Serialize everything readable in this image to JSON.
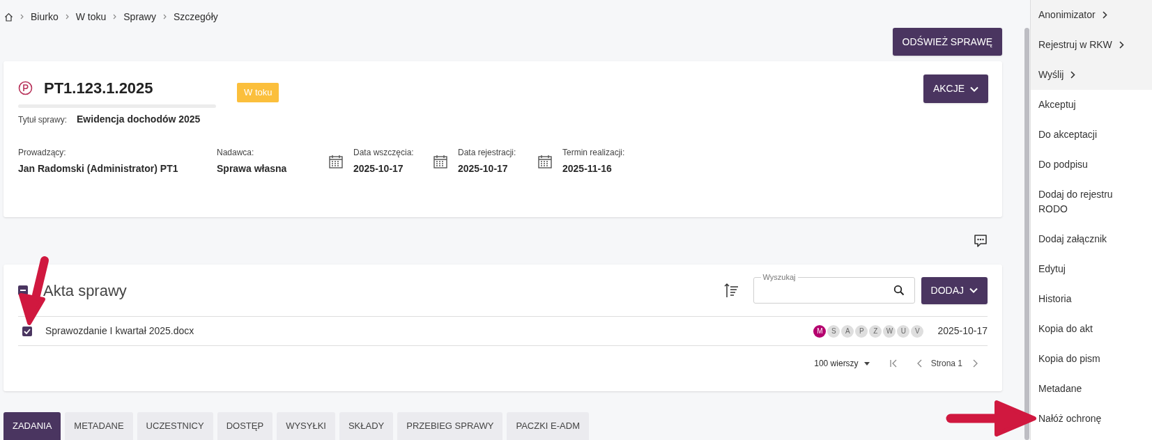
{
  "breadcrumb": [
    "Biurko",
    "W toku",
    "Sprawy",
    "Szczegóły"
  ],
  "refresh_button": "ODŚWIEŻ SPRAWĘ",
  "case": {
    "number": "PT1.123.1.2025",
    "status": "W toku",
    "actions_button": "AKCJE",
    "title_label": "Tytuł sprawy:",
    "title": "Ewidencja dochodów 2025",
    "fields": [
      {
        "kind": "plain",
        "label": "Prowadzący:",
        "value": "Jan Radomski (Administrator) PT1"
      },
      {
        "kind": "plain",
        "label": "Nadawca:",
        "value": "Sprawa własna"
      },
      {
        "kind": "date",
        "label": "Data wszczęcia:",
        "value": "2025-10-17"
      },
      {
        "kind": "date",
        "label": "Data rejestracji:",
        "value": "2025-10-17"
      },
      {
        "kind": "date",
        "label": "Termin realizacji:",
        "value": "2025-11-16"
      }
    ]
  },
  "files": {
    "title": "Akta sprawy",
    "select_all_indeterminate": true,
    "search": {
      "label": "Wyszukaj"
    },
    "add_button": "DODAJ",
    "rows": [
      {
        "name": "Sprawozdanie I kwartał 2025.docx",
        "checked": true,
        "date": "2025-10-17",
        "flags": [
          {
            "letter": "M",
            "active": true
          },
          {
            "letter": "S",
            "active": false
          },
          {
            "letter": "A",
            "active": false
          },
          {
            "letter": "P",
            "active": false
          },
          {
            "letter": "Z",
            "active": false
          },
          {
            "letter": "W",
            "active": false
          },
          {
            "letter": "U",
            "active": false
          },
          {
            "letter": "V",
            "active": false
          }
        ]
      }
    ],
    "rows_per_page": "100 wierszy",
    "page": "Strona 1"
  },
  "tabs": [
    {
      "label": "ZADANIA",
      "selected": true
    },
    {
      "label": "METADANE",
      "selected": false
    },
    {
      "label": "UCZESTNICY",
      "selected": false
    },
    {
      "label": "DOSTĘP",
      "selected": false
    },
    {
      "label": "WYSYŁKI",
      "selected": false
    },
    {
      "label": "SKŁADY",
      "selected": false
    },
    {
      "label": "PRZEBIEG SPRAWY",
      "selected": false
    },
    {
      "label": "PACZKI E-ADM",
      "selected": false
    }
  ],
  "actions_menu": [
    {
      "label": "Anonimizator",
      "submenu": true
    },
    {
      "label": "Rejestruj w RKW",
      "submenu": true
    },
    {
      "label": "Wyślij",
      "submenu": true
    },
    {
      "label": "Akceptuj",
      "submenu": false
    },
    {
      "label": "Do akceptacji",
      "submenu": false
    },
    {
      "label": "Do podpisu",
      "submenu": false
    },
    {
      "label": "Dodaj do rejestru RODO",
      "submenu": false
    },
    {
      "label": "Dodaj załącznik",
      "submenu": false
    },
    {
      "label": "Edytuj",
      "submenu": false
    },
    {
      "label": "Historia",
      "submenu": false
    },
    {
      "label": "Kopia do akt",
      "submenu": false
    },
    {
      "label": "Kopia do pism",
      "submenu": false
    },
    {
      "label": "Metadane",
      "submenu": false
    },
    {
      "label": "Nałóż ochronę",
      "submenu": false
    }
  ]
}
